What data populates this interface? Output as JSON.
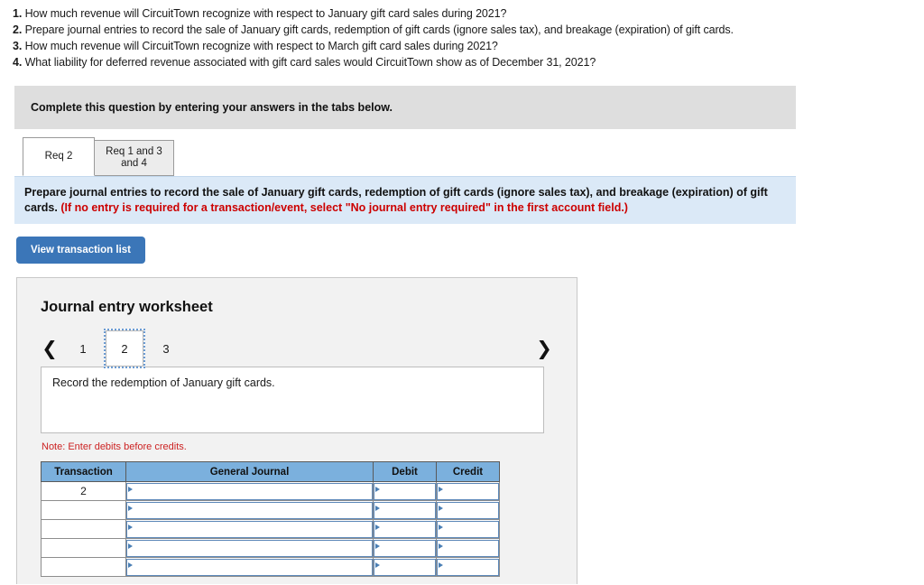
{
  "questions": [
    {
      "num": "1.",
      "text": "How much revenue will CircuitTown recognize with respect to January gift card sales during 2021?"
    },
    {
      "num": "2.",
      "text": "Prepare journal entries to record the sale of January gift cards, redemption of gift cards (ignore sales tax), and breakage (expiration) of gift cards."
    },
    {
      "num": "3.",
      "text": "How much revenue will CircuitTown recognize with respect to March gift card sales during 2021?"
    },
    {
      "num": "4.",
      "text": "What liability for deferred revenue associated with gift card sales would CircuitTown show as of December 31, 2021?"
    }
  ],
  "instruction_bar": {
    "text": "Complete this question by entering your answers in the tabs below."
  },
  "tabs": [
    {
      "label": "Req 2",
      "active": true
    },
    {
      "label": "Req 1 and 3 and 4",
      "active": false
    }
  ],
  "requirement_box": {
    "main_text": "Prepare journal entries to record the sale of January gift cards, redemption of gift cards (ignore sales tax), and breakage (expiration) of gift cards.",
    "red_text": "(If no entry is required for a transaction/event, select \"No journal entry required\" in the first account field.)"
  },
  "transaction_button": {
    "label": "View transaction list"
  },
  "worksheet": {
    "title": "Journal entry worksheet",
    "pager": {
      "prev_icon": "chevron-left",
      "next_icon": "chevron-right",
      "pages": [
        "1",
        "2",
        "3"
      ],
      "selected": "2"
    },
    "description": "Record the redemption of January gift cards.",
    "note": "Note: Enter debits before credits.",
    "table": {
      "headers": [
        "Transaction",
        "General Journal",
        "Debit",
        "Credit"
      ],
      "rows": [
        {
          "transaction": "2",
          "general_journal": "",
          "debit": "",
          "credit": ""
        },
        {
          "transaction": "",
          "general_journal": "",
          "debit": "",
          "credit": ""
        },
        {
          "transaction": "",
          "general_journal": "",
          "debit": "",
          "credit": ""
        },
        {
          "transaction": "",
          "general_journal": "",
          "debit": "",
          "credit": ""
        },
        {
          "transaction": "",
          "general_journal": "",
          "debit": "",
          "credit": ""
        }
      ]
    }
  },
  "colors": {
    "header_blue": "#7bb0dd",
    "button_blue": "#3b76b8",
    "box_blue": "#dbe9f7",
    "bar_gray": "#dedede",
    "red": "#cc0000"
  }
}
